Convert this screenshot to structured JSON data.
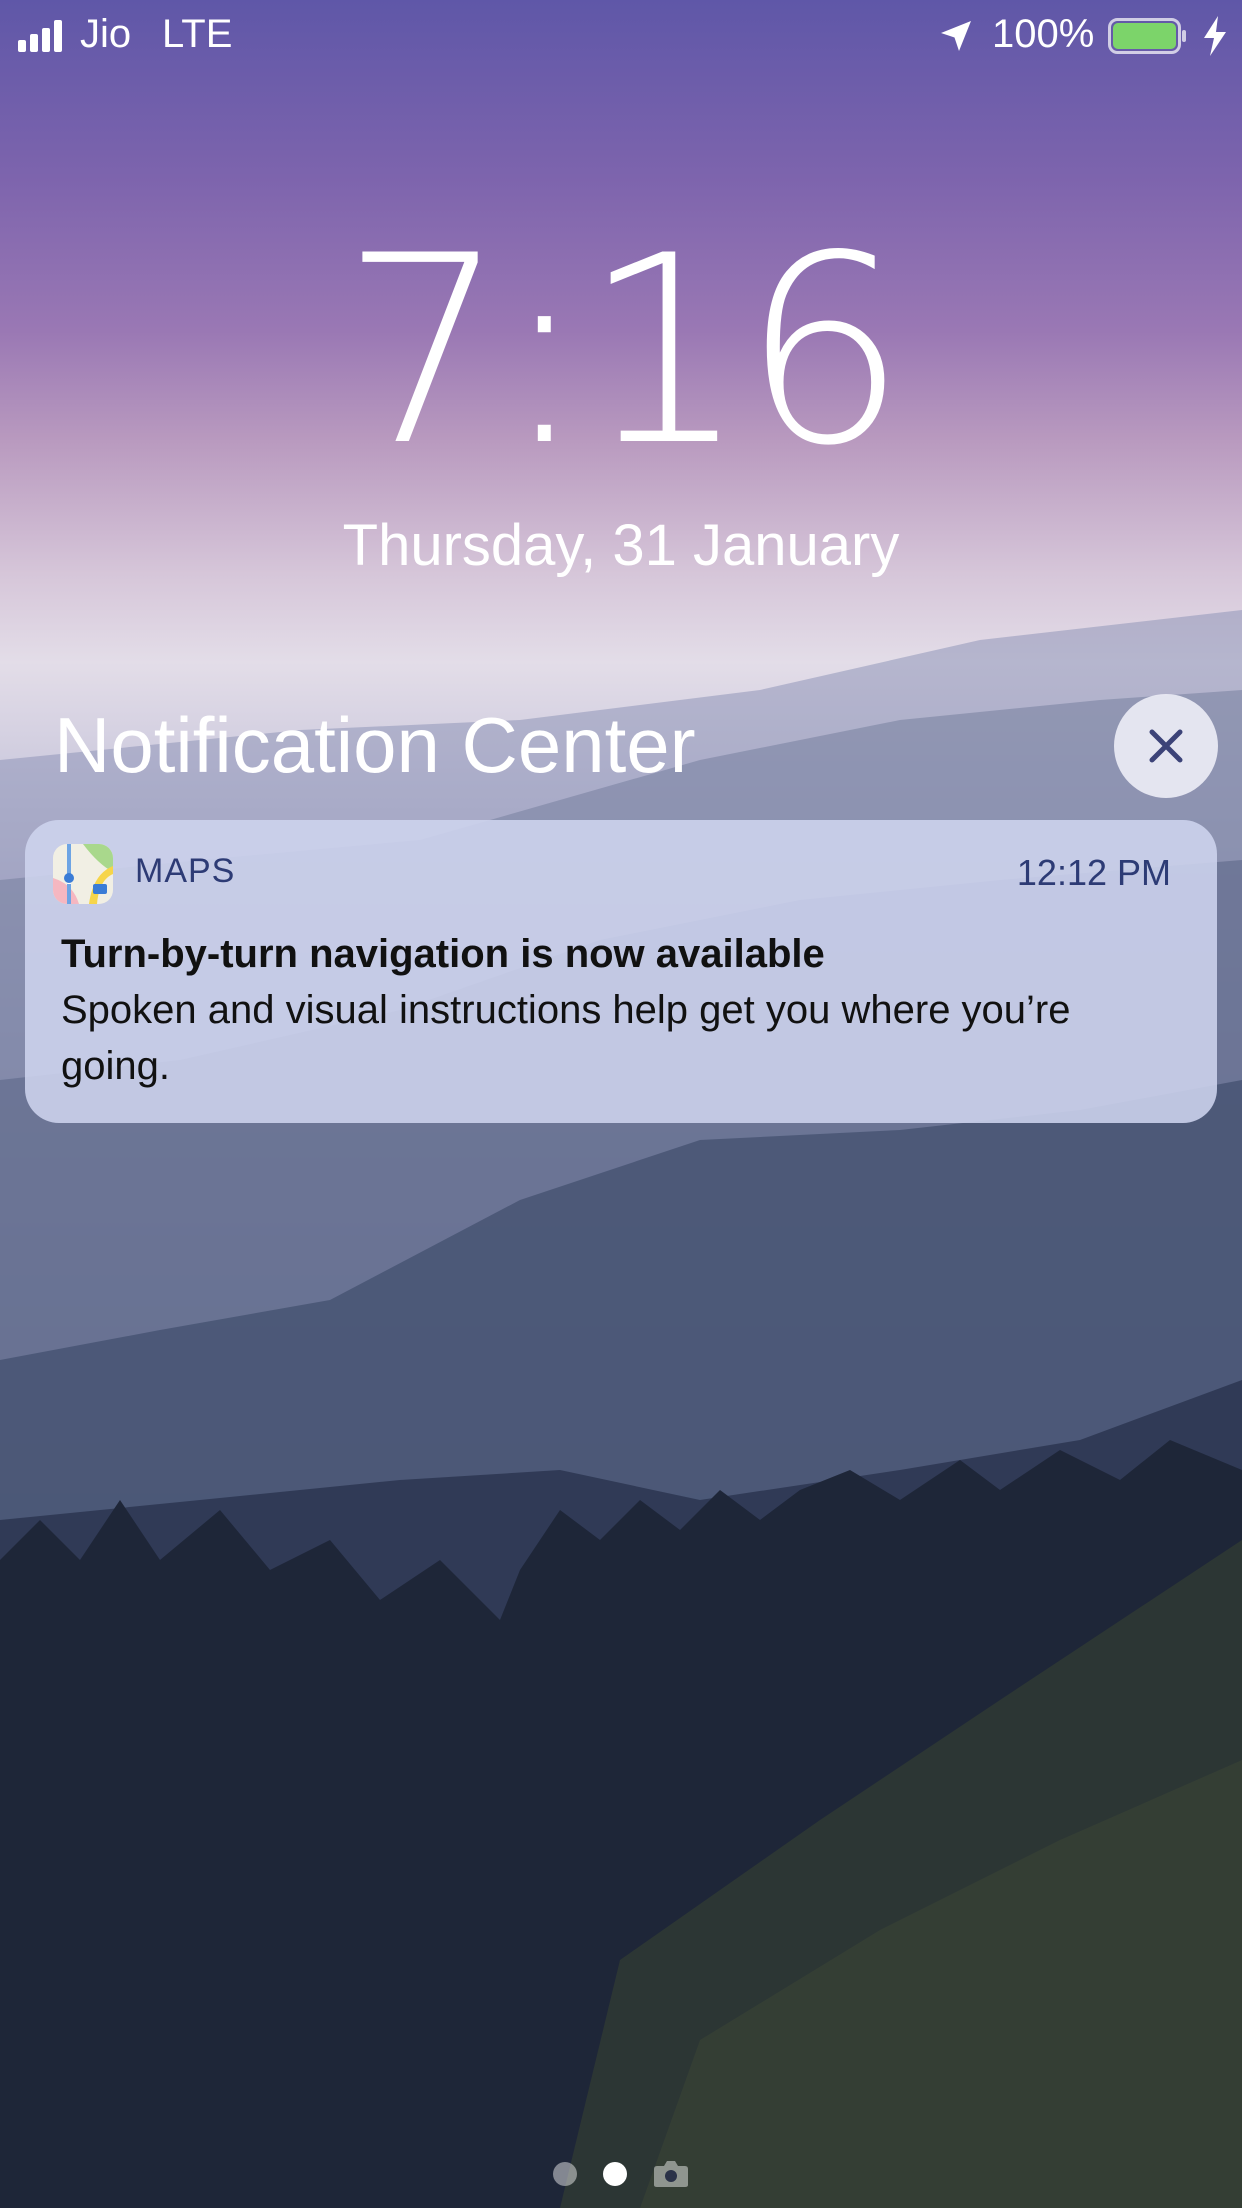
{
  "status_bar": {
    "carrier": "Jio",
    "network": "LTE",
    "battery_percent": "100%",
    "icons": [
      "signal-icon",
      "location-icon",
      "battery-icon",
      "charging-icon"
    ],
    "battery_color": "#7cd46a"
  },
  "lock_screen": {
    "time": "7:16",
    "date": "Thursday, 31 January"
  },
  "notification_center": {
    "title": "Notification Center",
    "close_icon": "close-icon"
  },
  "notification": {
    "app_name": "MAPS",
    "time": "12:12 PM",
    "title": "Turn-by-turn navigation is now available",
    "body": "Spoken and visual instructions help get you where you’re going.",
    "app_icon": "maps-app-icon"
  },
  "pager": {
    "pages": 2,
    "current_page": 2,
    "camera_icon": "camera-icon"
  },
  "colors": {
    "notification_text_accent": "#2d3b75",
    "close_button_bg": "#ebebf5"
  }
}
